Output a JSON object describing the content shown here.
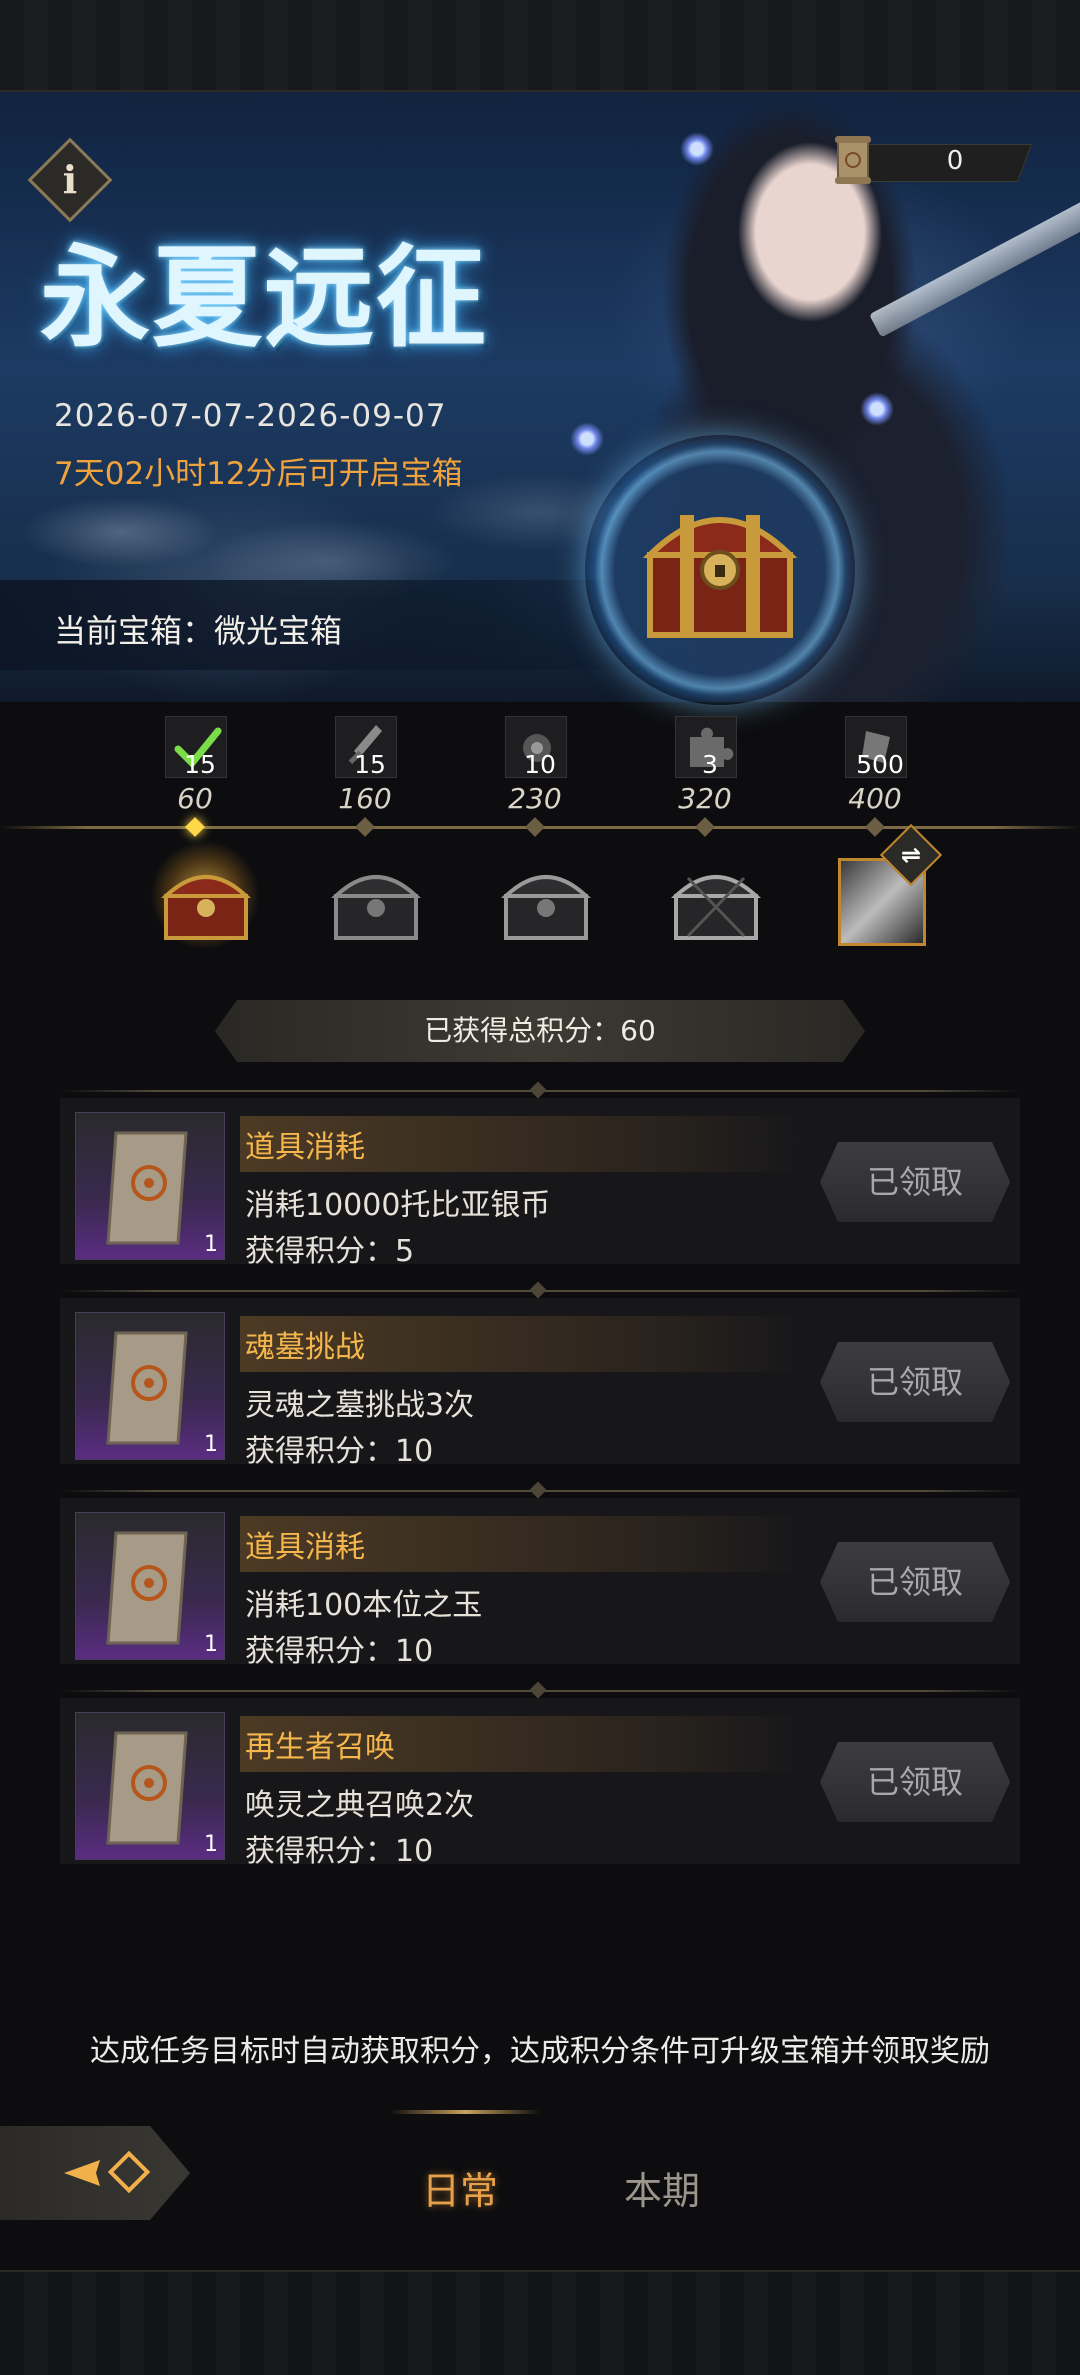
{
  "banner": {
    "title": "永夏远征",
    "date_range": "2026-07-07-2026-09-07",
    "countdown": "7天02小时12分后可开启宝箱",
    "current_chest": "当前宝箱：微光宝箱",
    "currency_value": "0"
  },
  "milestones": [
    {
      "count": "15",
      "score": "60",
      "reached": true
    },
    {
      "count": "15",
      "score": "160",
      "reached": false
    },
    {
      "count": "10",
      "score": "230",
      "reached": false
    },
    {
      "count": "3",
      "score": "320",
      "reached": false
    },
    {
      "count": "500",
      "score": "400",
      "reached": false
    }
  ],
  "total_score": "已获得总积分：60",
  "tasks": [
    {
      "name": "道具消耗",
      "desc": "消耗10000托比亚银币",
      "points": "获得积分：5",
      "qty": "1",
      "button": "已领取"
    },
    {
      "name": "魂墓挑战",
      "desc": "灵魂之墓挑战3次",
      "points": "获得积分：10",
      "qty": "1",
      "button": "已领取"
    },
    {
      "name": "道具消耗",
      "desc": "消耗100本位之玉",
      "points": "获得积分：10",
      "qty": "1",
      "button": "已领取"
    },
    {
      "name": "再生者召唤",
      "desc": "唤灵之典召唤2次",
      "points": "获得积分：10",
      "qty": "1",
      "button": "已领取"
    }
  ],
  "hint": "达成任务目标时自动获取积分，达成积分条件可升级宝箱并领取奖励",
  "tabs": [
    {
      "label": "日常",
      "active": true
    },
    {
      "label": "本期",
      "active": false
    }
  ],
  "icons": {
    "info": "info-icon",
    "currency": "scroll-icon",
    "back": "back-arrow-icon",
    "swap": "swap-icon"
  },
  "colors": {
    "accent_orange": "#f0a23c",
    "task_title": "#f5b64d",
    "tab_active": "#e7a04a",
    "tab_inactive": "#9b958b"
  }
}
